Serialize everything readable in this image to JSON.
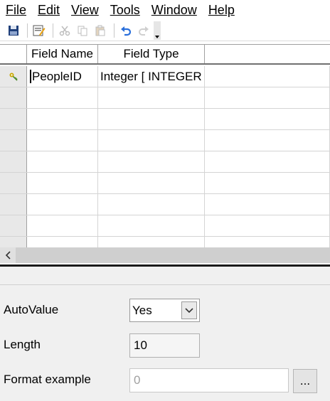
{
  "menu": {
    "items": [
      {
        "label": "File"
      },
      {
        "label": "Edit"
      },
      {
        "label": "View"
      },
      {
        "label": "Tools"
      },
      {
        "label": "Window"
      },
      {
        "label": "Help"
      }
    ]
  },
  "toolbar": {
    "buttons": [
      "save-icon",
      "edit-properties-icon",
      "cut-icon",
      "copy-icon",
      "paste-icon",
      "undo-icon",
      "redo-icon"
    ]
  },
  "table": {
    "columns": [
      "Field Name",
      "Field Type"
    ],
    "rows": [
      {
        "name": "PeopleID",
        "type": "Integer [ INTEGER ]",
        "primary_key": true
      }
    ]
  },
  "properties": {
    "autovalue": {
      "label": "AutoValue",
      "value": "Yes"
    },
    "length": {
      "label": "Length",
      "value": "10"
    },
    "format_example": {
      "label": "Format example",
      "value": "0",
      "button": "..."
    }
  },
  "colors": {
    "key_icon": "#c8a800",
    "undo_icon": "#2a6fdb",
    "panel_bg": "#f0f0f0"
  }
}
